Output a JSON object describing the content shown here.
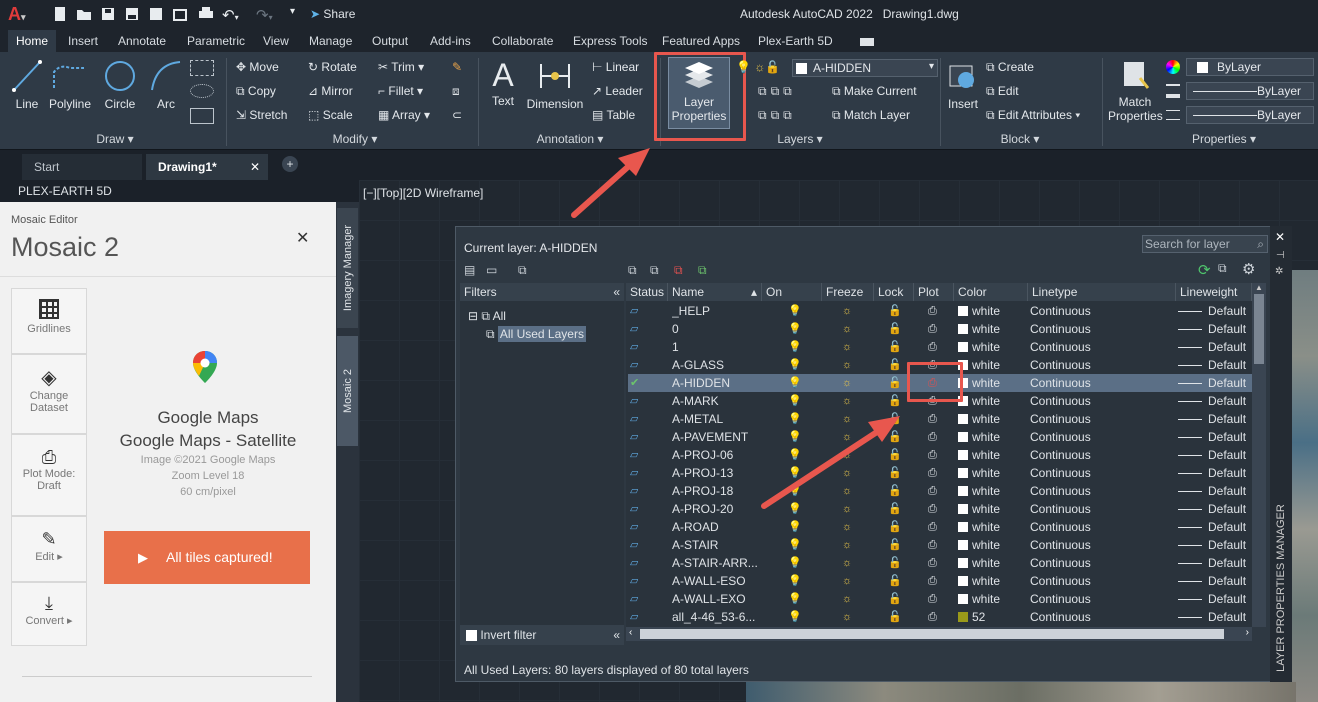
{
  "window": {
    "title": "Autodesk AutoCAD 2022   Drawing1.dwg",
    "share_label": "Share"
  },
  "ribbon_tabs": [
    "Home",
    "Insert",
    "Annotate",
    "Parametric",
    "View",
    "Manage",
    "Output",
    "Add-ins",
    "Collaborate",
    "Express Tools",
    "Featured Apps",
    "Plex-Earth 5D"
  ],
  "draw": {
    "label": "Draw ▾",
    "line": "Line",
    "polyline": "Polyline",
    "circle": "Circle",
    "arc": "Arc"
  },
  "modify": {
    "label": "Modify ▾",
    "move": "Move",
    "rotate": "Rotate",
    "trim": "Trim",
    "copy": "Copy",
    "mirror": "Mirror",
    "fillet": "Fillet",
    "stretch": "Stretch",
    "scale": "Scale",
    "array": "Array"
  },
  "annotation": {
    "label": "Annotation ▾",
    "text": "Text",
    "dimension": "Dimension",
    "linear": "Linear",
    "leader": "Leader",
    "table": "Table"
  },
  "layers": {
    "label": "Layers ▾",
    "layer_properties": "Layer\nProperties",
    "current_layer": "A-HIDDEN",
    "make_current": "Make Current",
    "match_layer": "Match Layer"
  },
  "block": {
    "label": "Block ▾",
    "insert": "Insert",
    "create": "Create",
    "edit": "Edit",
    "edit_attributes": "Edit Attributes"
  },
  "properties": {
    "label": "Properties ▾",
    "match_properties": "Match\nProperties",
    "bylayer_color": "ByLayer",
    "bylayer_line1": "ByLayer",
    "bylayer_line2": "ByLayer"
  },
  "doc_tabs": {
    "start": "Start",
    "drawing": "Drawing1*"
  },
  "viewport_label": "[−][Top][2D Wireframe]",
  "plex": {
    "header": "PLEX-EARTH 5D",
    "subtitle": "Mosaic Editor",
    "title": "Mosaic 2",
    "tools": [
      "Gridlines",
      "Change Dataset",
      "Plot Mode: Draft",
      "Edit ▸",
      "Convert ▸"
    ],
    "provider": "Google Maps",
    "dataset": "Google Maps - Satellite",
    "copyright": "Image ©2021 Google Maps",
    "zoom": "Zoom Level 18",
    "resolution": "60 cm/pixel",
    "capture_button": "All tiles captured!",
    "vtab_imagery": "Imagery Manager",
    "vtab_mosaic": "Mosaic 2"
  },
  "lpm": {
    "current_layer": "Current layer: A-HIDDEN",
    "search_placeholder": "Search for layer",
    "filters_label": "Filters",
    "filter_all": "All",
    "filter_used": "All Used Layers",
    "invert_filter": "Invert filter",
    "status_bar": "All Used Layers: 80 layers displayed of 80 total layers",
    "side_title": "LAYER PROPERTIES MANAGER",
    "columns": [
      "Status",
      "Name",
      "On",
      "Freeze",
      "Lock",
      "Plot",
      "Color",
      "Linetype",
      "Lineweight"
    ],
    "rows": [
      {
        "name": "_HELP",
        "color": "white",
        "linetype": "Continuous",
        "lineweight": "Default"
      },
      {
        "name": "0",
        "color": "white",
        "linetype": "Continuous",
        "lineweight": "Default"
      },
      {
        "name": "1",
        "color": "white",
        "linetype": "Continuous",
        "lineweight": "Default"
      },
      {
        "name": "A-GLASS",
        "color": "white",
        "linetype": "Continuous",
        "lineweight": "Default"
      },
      {
        "name": "A-HIDDEN",
        "color": "white",
        "linetype": "Continuous",
        "lineweight": "Default",
        "current": true
      },
      {
        "name": "A-MARK",
        "color": "white",
        "linetype": "Continuous",
        "lineweight": "Default"
      },
      {
        "name": "A-METAL",
        "color": "white",
        "linetype": "Continuous",
        "lineweight": "Default"
      },
      {
        "name": "A-PAVEMENT",
        "color": "white",
        "linetype": "Continuous",
        "lineweight": "Default"
      },
      {
        "name": "A-PROJ-06",
        "color": "white",
        "linetype": "Continuous",
        "lineweight": "Default"
      },
      {
        "name": "A-PROJ-13",
        "color": "white",
        "linetype": "Continuous",
        "lineweight": "Default"
      },
      {
        "name": "A-PROJ-18",
        "color": "white",
        "linetype": "Continuous",
        "lineweight": "Default"
      },
      {
        "name": "A-PROJ-20",
        "color": "white",
        "linetype": "Continuous",
        "lineweight": "Default"
      },
      {
        "name": "A-ROAD",
        "color": "white",
        "linetype": "Continuous",
        "lineweight": "Default"
      },
      {
        "name": "A-STAIR",
        "color": "white",
        "linetype": "Continuous",
        "lineweight": "Default"
      },
      {
        "name": "A-STAIR-ARR...",
        "color": "white",
        "linetype": "Continuous",
        "lineweight": "Default"
      },
      {
        "name": "A-WALL-ESO",
        "color": "white",
        "linetype": "Continuous",
        "lineweight": "Default"
      },
      {
        "name": "A-WALL-EXO",
        "color": "white",
        "linetype": "Continuous",
        "lineweight": "Default"
      },
      {
        "name": "all_4-46_53-6...",
        "color": "52",
        "linetype": "Continuous",
        "lineweight": "Default",
        "swatch": "#9a9a1a"
      }
    ]
  },
  "colors": {
    "accent": "#e8574e",
    "button": "#e8704a"
  }
}
